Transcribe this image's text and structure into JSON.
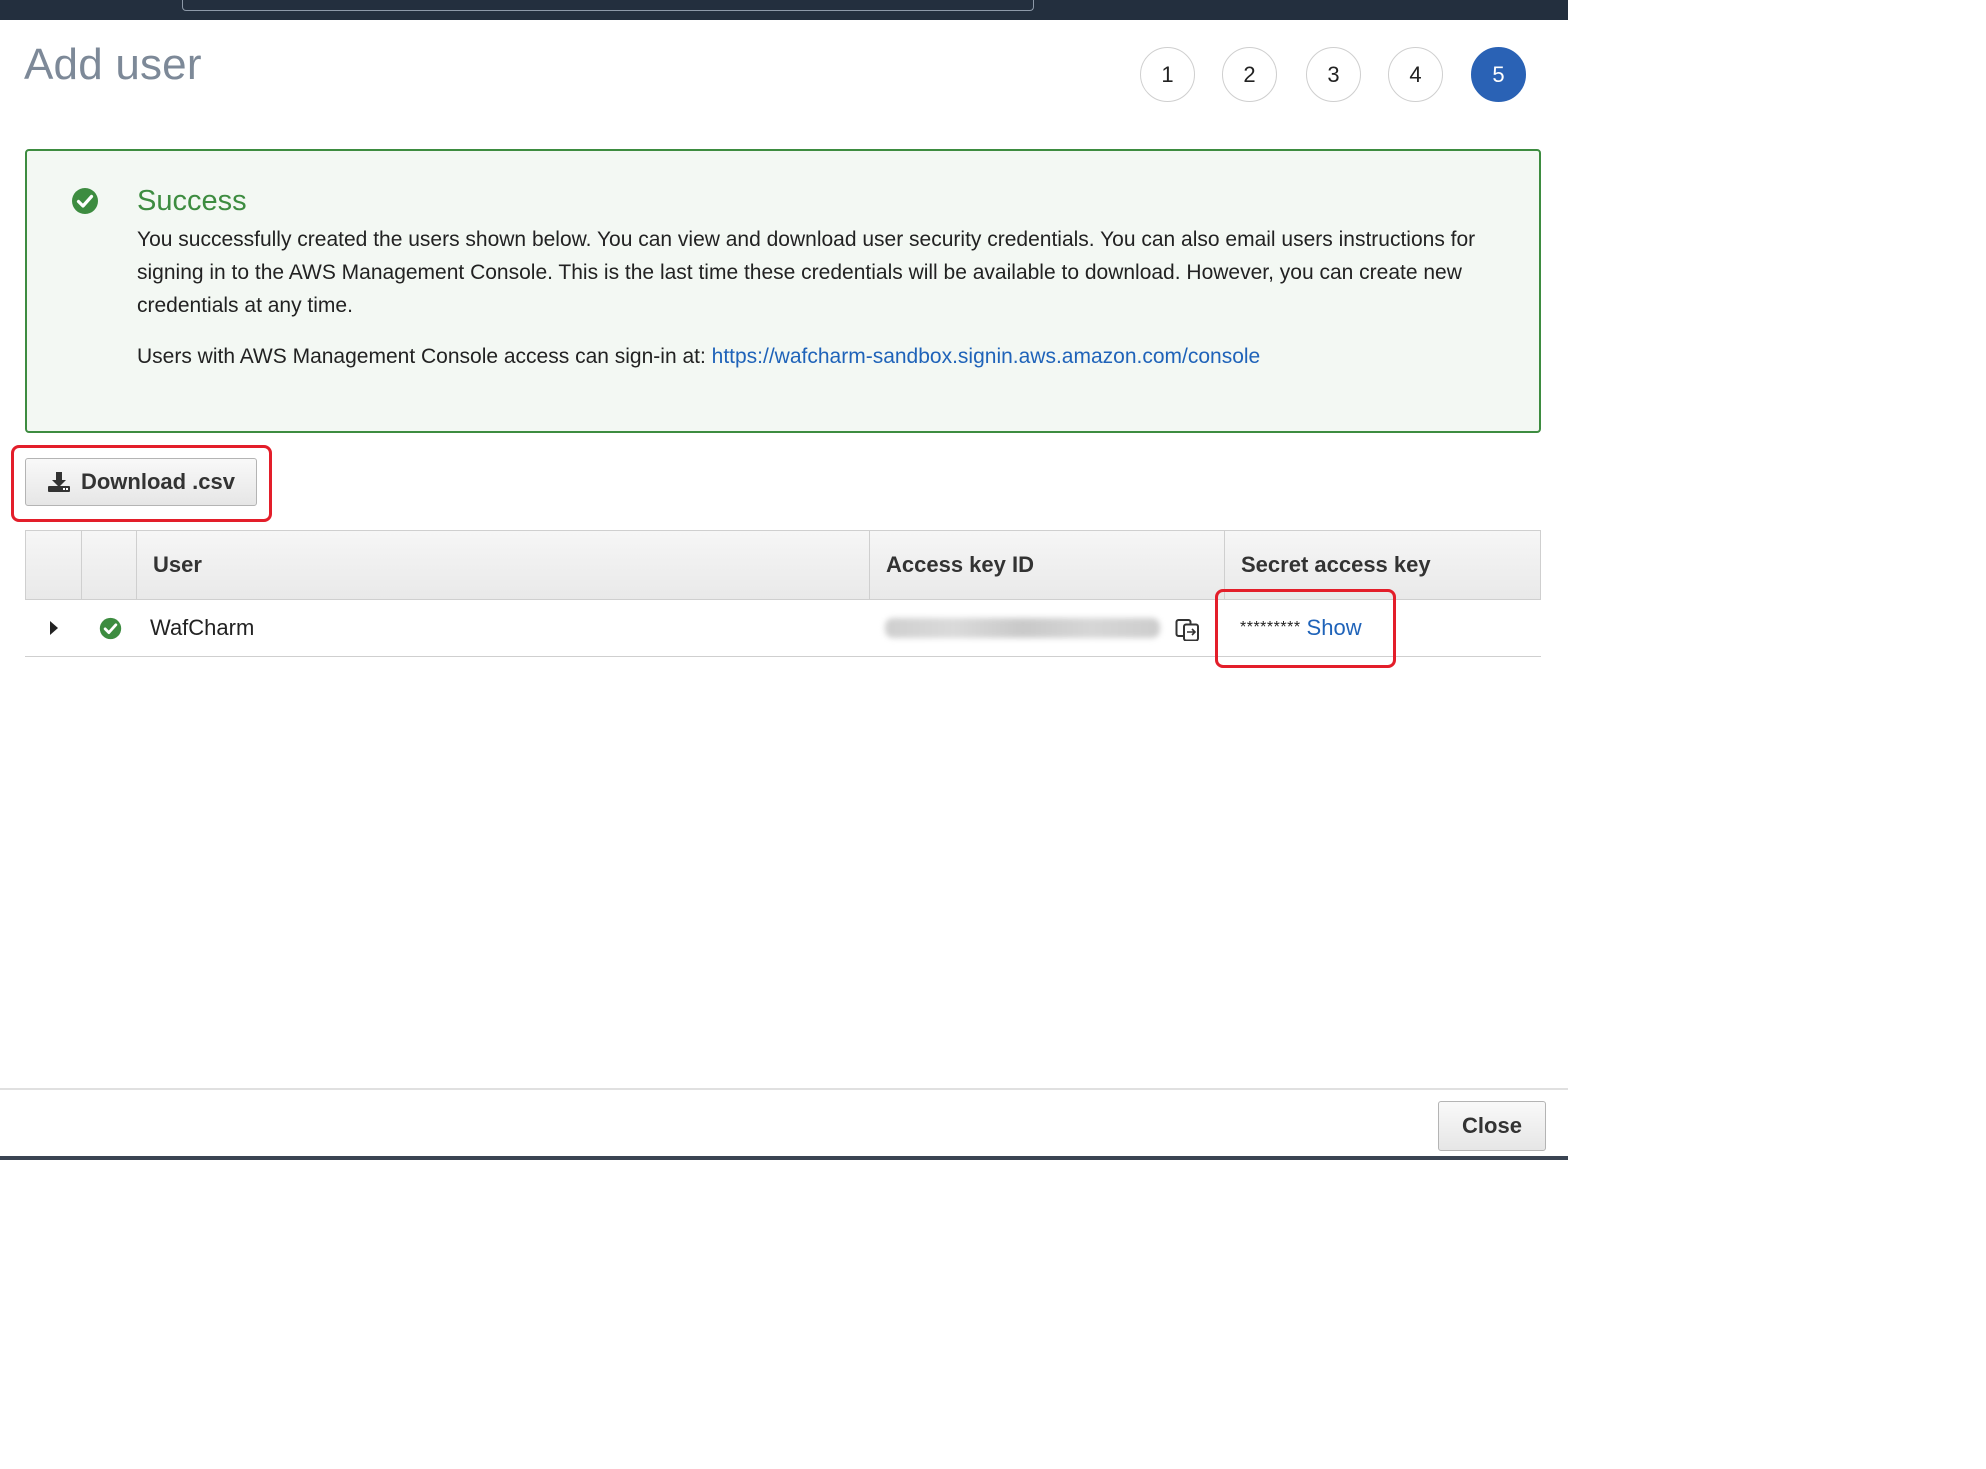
{
  "page": {
    "title": "Add user"
  },
  "steps": [
    "1",
    "2",
    "3",
    "4",
    "5"
  ],
  "active_step": "5",
  "alert": {
    "heading": "Success",
    "body": "You successfully created the users shown below. You can view and download user security credentials. You can also email users instructions for signing in to the AWS Management Console. This is the last time these credentials will be available to download. However, you can create new credentials at any time.",
    "signin_prefix": "Users with AWS Management Console access can sign-in at: ",
    "signin_link": "https://wafcharm-sandbox.signin.aws.amazon.com/console"
  },
  "download_button": "Download .csv",
  "table": {
    "headers": {
      "user": "User",
      "access_key": "Access key ID",
      "secret_key": "Secret access key"
    },
    "rows": [
      {
        "user": "WafCharm",
        "secret_mask": "*********",
        "secret_action": "Show"
      }
    ]
  },
  "footer": {
    "close_button": "Close"
  },
  "colors": {
    "success": "#3d8c40",
    "link": "#1f63b9",
    "active_step": "#2a62b5",
    "highlight": "#e31e2a"
  },
  "icons": [
    "success-check-icon",
    "download-icon",
    "expand-caret-icon",
    "row-success-icon",
    "copy-icon"
  ]
}
